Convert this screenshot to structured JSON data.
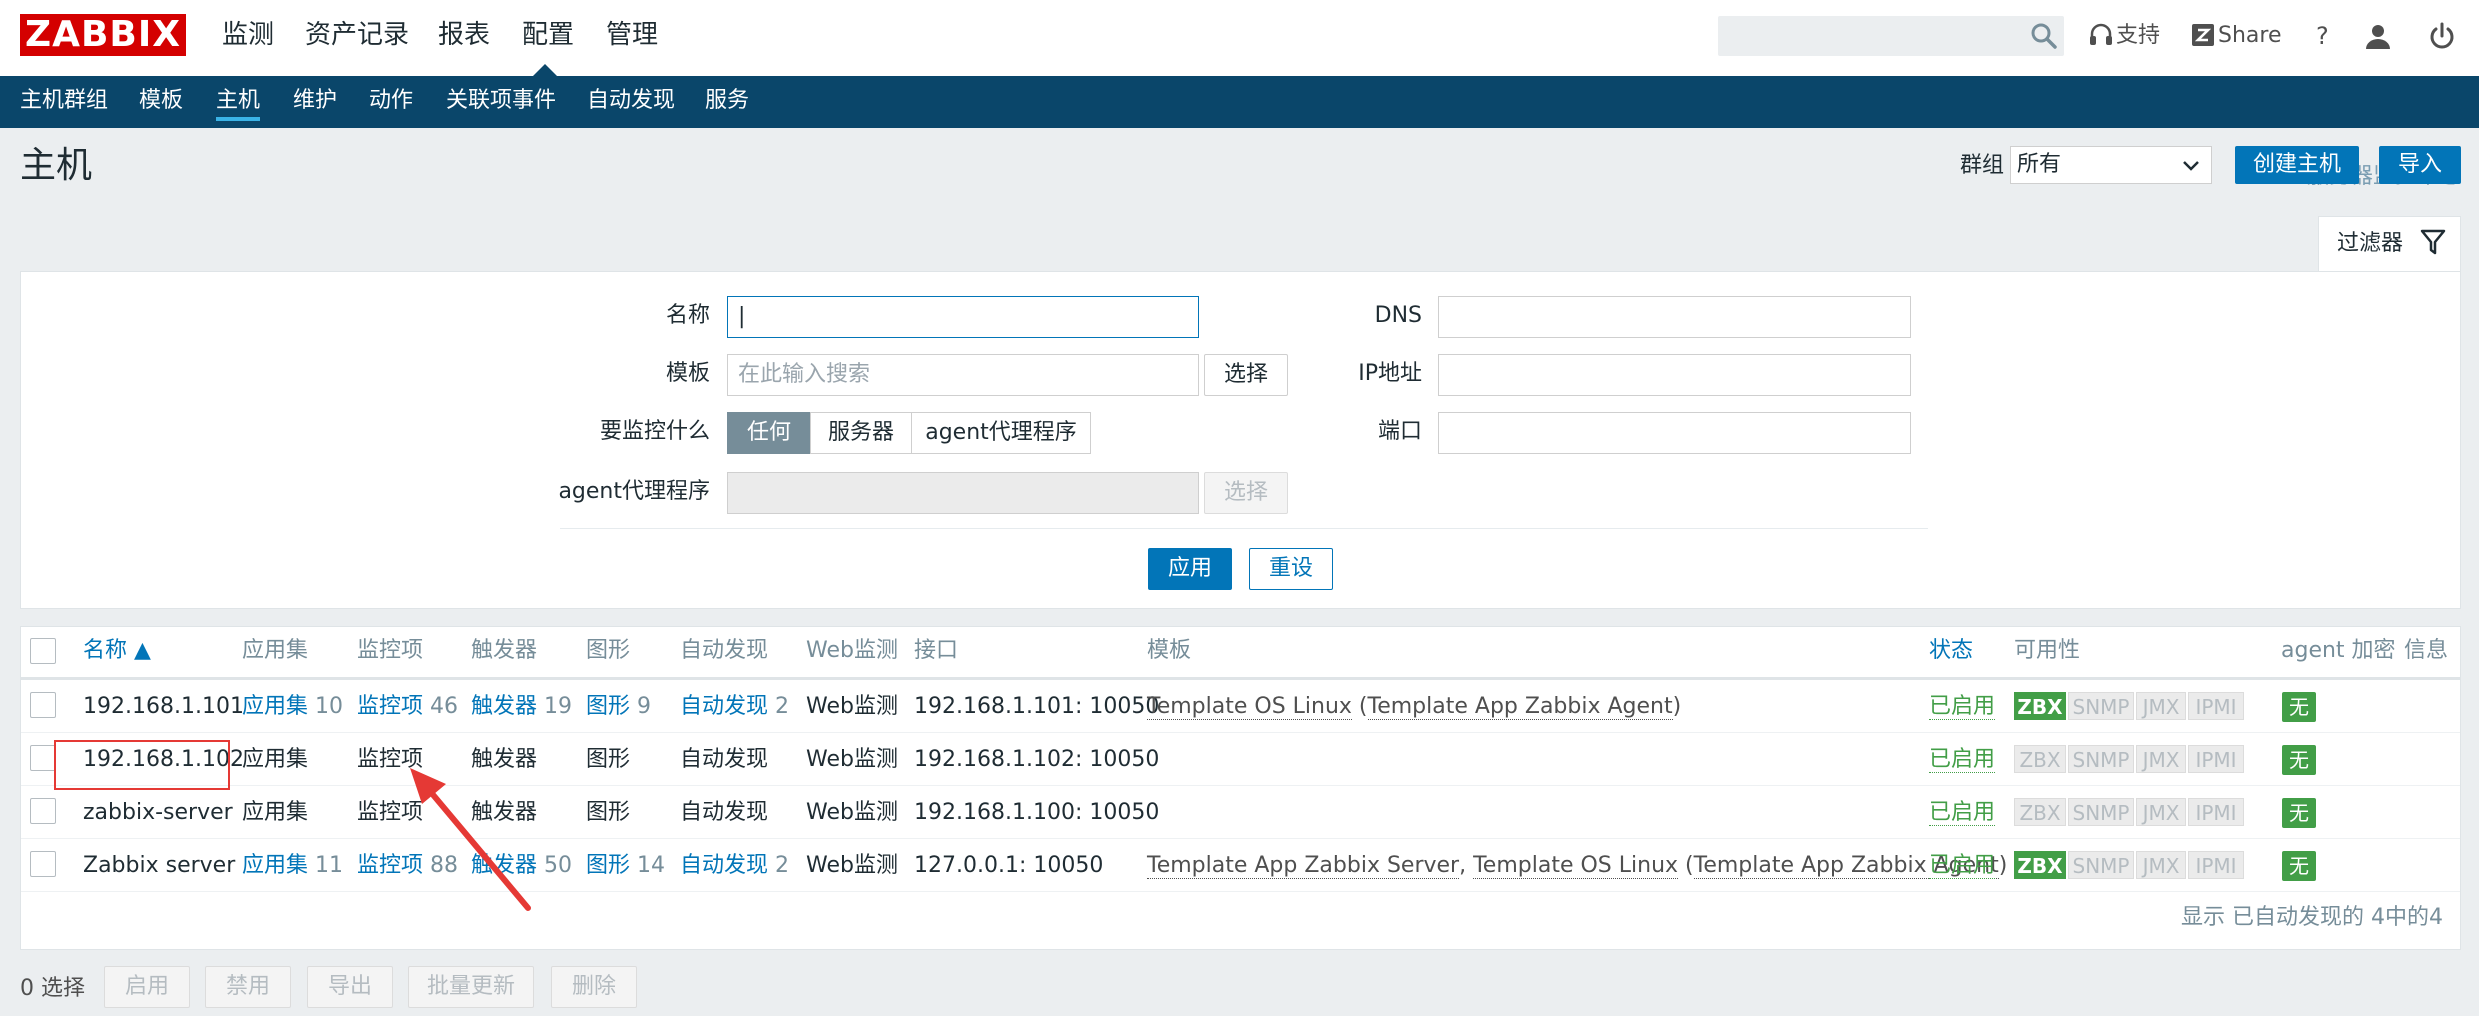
{
  "header": {
    "logo_text": "ZABBIX",
    "menu": [
      "监测",
      "资产记录",
      "报表",
      "配置",
      "管理"
    ],
    "active_menu": "配置",
    "support_label": "支持",
    "share_label": "Share",
    "help_label": "?"
  },
  "subnav": {
    "items": [
      "主机群组",
      "模板",
      "主机",
      "维护",
      "动作",
      "关联项事件",
      "自动发现",
      "服务"
    ],
    "active": "主机",
    "server_name": "服务器监控中心"
  },
  "page": {
    "title": "主机",
    "group_label": "群组",
    "group_value": "所有",
    "create_button": "创建主机",
    "import_button": "导入",
    "filter_tab": "过滤器"
  },
  "filter": {
    "name_label": "名称",
    "name_value": "|",
    "template_label": "模板",
    "template_placeholder": "在此输入搜索",
    "template_select": "选择",
    "monitor_label": "要监控什么",
    "monitor_options": [
      "任何",
      "服务器",
      "agent代理程序"
    ],
    "proxy_label": "agent代理程序",
    "proxy_select": "选择",
    "dns_label": "DNS",
    "ip_label": "IP地址",
    "port_label": "端口",
    "apply_button": "应用",
    "reset_button": "重设"
  },
  "table": {
    "columns": {
      "name": "名称 ▲",
      "apps": "应用集",
      "items": "监控项",
      "triggers": "触发器",
      "graphs": "图形",
      "discovery": "自动发现",
      "web": "Web监测",
      "interface": "接口",
      "templates": "模板",
      "status": "状态",
      "availability": "可用性",
      "encryption": "agent 加密",
      "info": "信息"
    },
    "rows": [
      {
        "name": "192.168.1.101",
        "apps": "应用集",
        "apps_count": "10",
        "items": "监控项",
        "items_count": "46",
        "triggers": "触发器",
        "triggers_count": "19",
        "graphs": "图形",
        "graphs_count": "9",
        "discovery": "自动发现",
        "discovery_count": "2",
        "web": "Web监测",
        "interface": "192.168.1.101: 10050",
        "tpl1": "Template OS Linux",
        "tpl_sep": " (",
        "tpl2": "Template App Zabbix Agent",
        "tpl_end": ")",
        "status": "已启用",
        "zbx_on": true,
        "encryption": "无"
      },
      {
        "name": "192.168.1.102",
        "apps": "应用集",
        "apps_count": "",
        "items": "监控项",
        "items_count": "",
        "triggers": "触发器",
        "triggers_count": "",
        "graphs": "图形",
        "graphs_count": "",
        "discovery": "自动发现",
        "discovery_count": "",
        "web": "Web监测",
        "interface": "192.168.1.102: 10050",
        "status": "已启用",
        "zbx_on": false,
        "encryption": "无"
      },
      {
        "name": "zabbix-server",
        "apps": "应用集",
        "apps_count": "",
        "items": "监控项",
        "items_count": "",
        "triggers": "触发器",
        "triggers_count": "",
        "graphs": "图形",
        "graphs_count": "",
        "discovery": "自动发现",
        "discovery_count": "",
        "web": "Web监测",
        "interface": "192.168.1.100: 10050",
        "status": "已启用",
        "zbx_on": false,
        "encryption": "无"
      },
      {
        "name": "Zabbix server",
        "apps": "应用集",
        "apps_count": "11",
        "items": "监控项",
        "items_count": "88",
        "triggers": "触发器",
        "triggers_count": "50",
        "graphs": "图形",
        "graphs_count": "14",
        "discovery": "自动发现",
        "discovery_count": "2",
        "web": "Web监测",
        "interface": "127.0.0.1: 10050",
        "tpl1": "Template App Zabbix Server",
        "tpl_mid": ", ",
        "tpl2": "Template OS Linux",
        "tpl_sep": " (",
        "tpl3": "Template App Zabbix Agent",
        "tpl_end": ")",
        "status": "已启用",
        "zbx_on": true,
        "encryption": "无"
      }
    ],
    "availability_badges": [
      "ZBX",
      "SNMP",
      "JMX",
      "IPMI"
    ],
    "footer": "显示 已自动发现的 4中的4"
  },
  "actions": {
    "selected": "0 选择",
    "buttons": [
      "启用",
      "禁用",
      "导出",
      "批量更新",
      "删除"
    ]
  },
  "colors": {
    "brand_red": "#d40000",
    "nav_blue": "#0a466a",
    "link_blue": "#0275b8",
    "status_green": "#429e47",
    "annotation_red": "#e53935"
  }
}
